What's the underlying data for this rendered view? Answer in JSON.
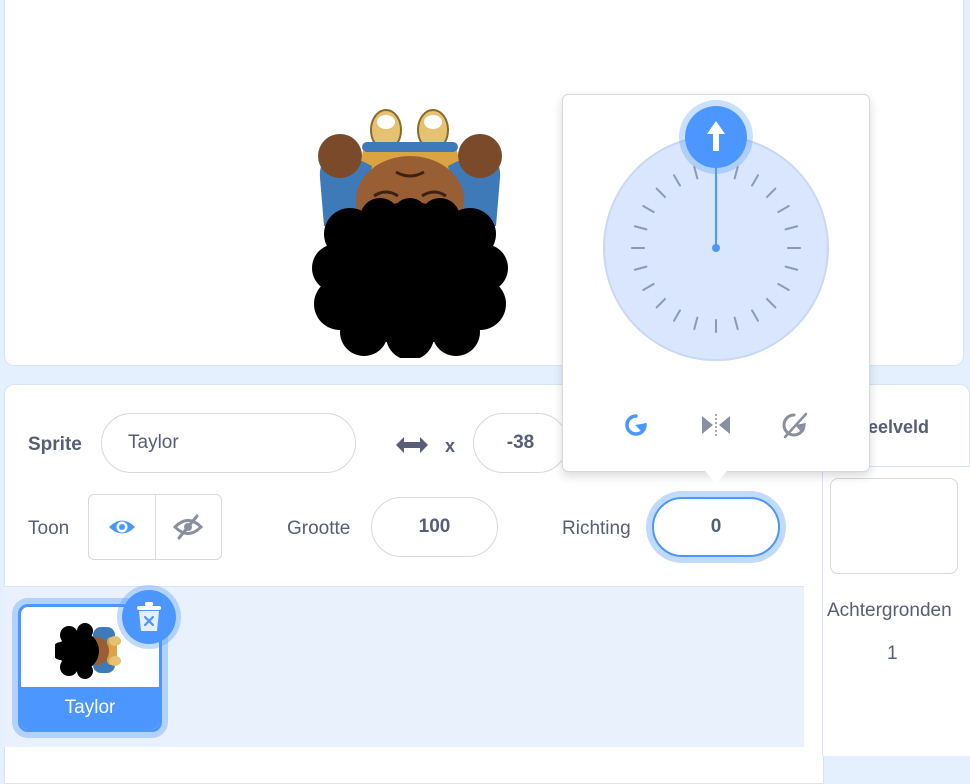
{
  "sprite_info": {
    "sprite_label": "Sprite",
    "sprite_name": "Taylor",
    "x_label": "x",
    "x_value": "-38",
    "show_label": "Toon",
    "size_label": "Grootte",
    "size_value": "100",
    "direction_label": "Richting",
    "direction_value": "0"
  },
  "sprite_list": [
    {
      "name": "Taylor",
      "selected": true
    }
  ],
  "stage_panel": {
    "title": "peelveld",
    "backdrops_label": "Achtergronden",
    "backdrops_count": "1"
  },
  "direction_popover": {
    "direction_degrees": 0,
    "rotation_styles": [
      "all-around-icon",
      "left-right-icon",
      "dont-rotate-icon"
    ],
    "active_style": "all-around-icon"
  },
  "colors": {
    "accent": "#4c97ff",
    "text": "#575e75",
    "dial_fill": "#d9e6fd"
  }
}
